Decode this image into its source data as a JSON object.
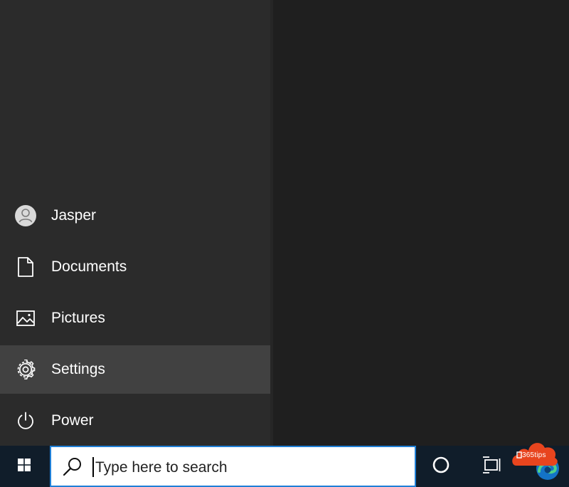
{
  "start_menu": {
    "items": [
      {
        "label": "Jasper",
        "icon": "user-avatar-icon"
      },
      {
        "label": "Documents",
        "icon": "document-icon"
      },
      {
        "label": "Pictures",
        "icon": "picture-icon"
      },
      {
        "label": "Settings",
        "icon": "gear-icon",
        "active": true
      },
      {
        "label": "Power",
        "icon": "power-icon"
      }
    ]
  },
  "taskbar": {
    "search_placeholder": "Type here to search",
    "start_icon": "windows-logo-icon",
    "cortana_icon": "cortana-circle-icon",
    "taskview_icon": "task-view-icon",
    "edge_icon": "edge-browser-icon"
  },
  "watermark": {
    "text": "365tips",
    "color": "#e8451e"
  },
  "colors": {
    "menu_bg": "#2b2b2b",
    "active_item_bg": "#414141",
    "taskbar_bg": "#101d2a",
    "search_border": "#1f7fd6"
  }
}
